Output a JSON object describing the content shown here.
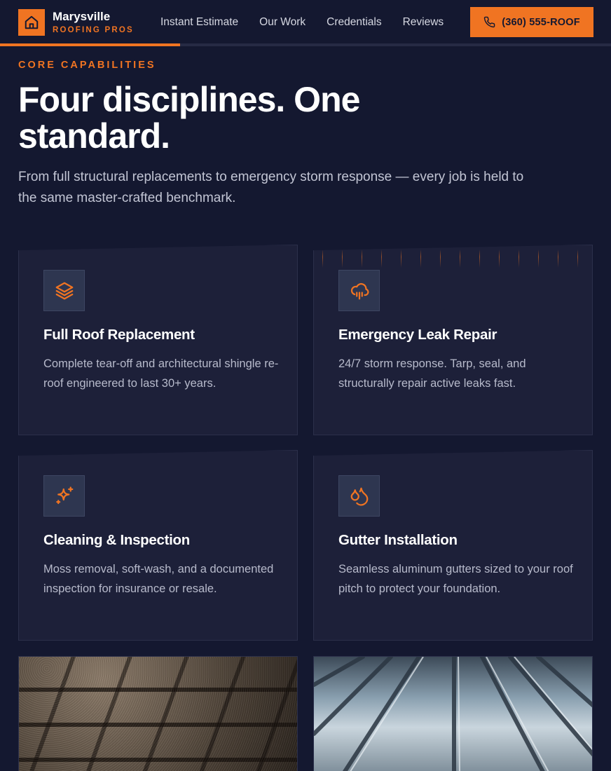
{
  "brand": {
    "name": "Marysville",
    "subtitle": "ROOFING PROS",
    "logo_icon": "house-icon"
  },
  "nav": {
    "items": [
      "Instant Estimate",
      "Our Work",
      "Credentials",
      "Reviews"
    ]
  },
  "cta": {
    "label": "(360) 555-ROOF",
    "icon": "phone-icon"
  },
  "intro": {
    "eyebrow": "CORE CAPABILITIES",
    "headline": "Four disciplines. One standard.",
    "lead": "From full structural replacements to emergency storm response — every job is held to the same master-crafted benchmark."
  },
  "services": [
    {
      "title": "Full Roof Replacement",
      "description": "Complete tear-off and architectural shingle re-roof engineered to last 30+ years.",
      "icon": "layers-icon"
    },
    {
      "title": "Emergency Leak Repair",
      "description": "24/7 storm response. Tarp, seal, and structurally repair active leaks fast.",
      "icon": "cloud-rain-icon"
    },
    {
      "title": "Cleaning & Inspection",
      "description": "Moss removal, soft-wash, and a documented inspection for insurance or resale.",
      "icon": "sparkles-icon"
    },
    {
      "title": "Gutter Installation",
      "description": "Seamless aluminum gutters sized to your roof pitch to protect your foundation.",
      "icon": "droplets-icon"
    }
  ],
  "colors": {
    "accent": "#f07422",
    "background": "#141830",
    "card": "#1d2039",
    "text_muted": "#b7bacb"
  }
}
